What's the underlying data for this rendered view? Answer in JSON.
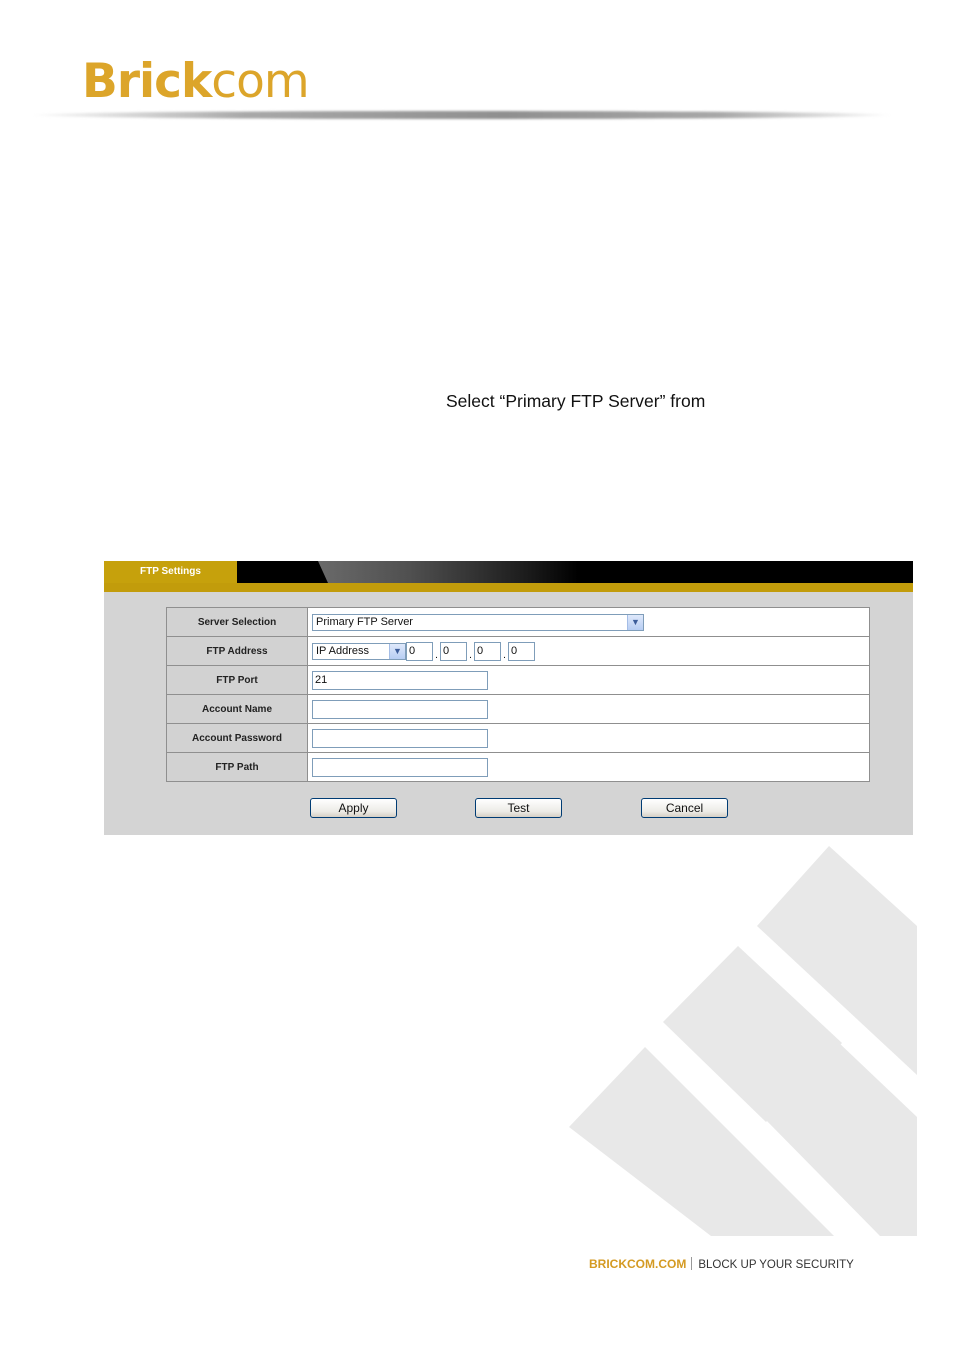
{
  "header": {
    "logo_bold": "Brick",
    "logo_light": "com"
  },
  "body_text": "Select “Primary FTP Server” from",
  "panel": {
    "tab_label": "FTP Settings",
    "rows": [
      {
        "label": "Server Selection",
        "value": "Primary FTP Server"
      },
      {
        "label": "FTP Address",
        "type": "IP Address",
        "octets": [
          "0",
          "0",
          "0",
          "0"
        ]
      },
      {
        "label": "FTP Port",
        "value": "21"
      },
      {
        "label": "Account Name",
        "value": ""
      },
      {
        "label": "Account Password",
        "value": ""
      },
      {
        "label": "FTP Path",
        "value": ""
      }
    ],
    "buttons": {
      "apply": "Apply",
      "test": "Test",
      "cancel": "Cancel"
    }
  },
  "footer": {
    "brand": "BRICKCOM.COM",
    "tagline": "BLOCK UP YOUR SECURITY"
  },
  "colors": {
    "brand_gold": "#dca52a",
    "tab_gold": "#c6a10c",
    "panel_gray": "#d4d4d4"
  }
}
